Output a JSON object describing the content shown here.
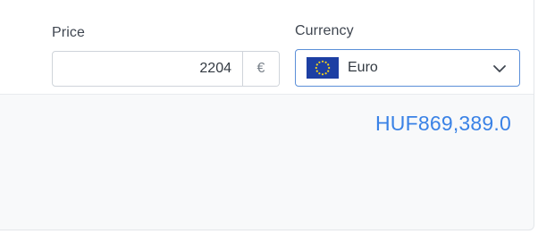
{
  "form": {
    "price_label": "Price",
    "price_value": "2204",
    "price_suffix_symbol": "€",
    "currency_label": "Currency",
    "currency_selected": "Euro",
    "currency_flag_icon": "eu-flag-icon",
    "dropdown_icon": "chevron-down-icon"
  },
  "result": {
    "converted_amount": "HUF869,389.0"
  },
  "colors": {
    "accent": "#3a82e6",
    "select_border": "#5b8fd8",
    "panel_bg": "#f8f9fa"
  }
}
